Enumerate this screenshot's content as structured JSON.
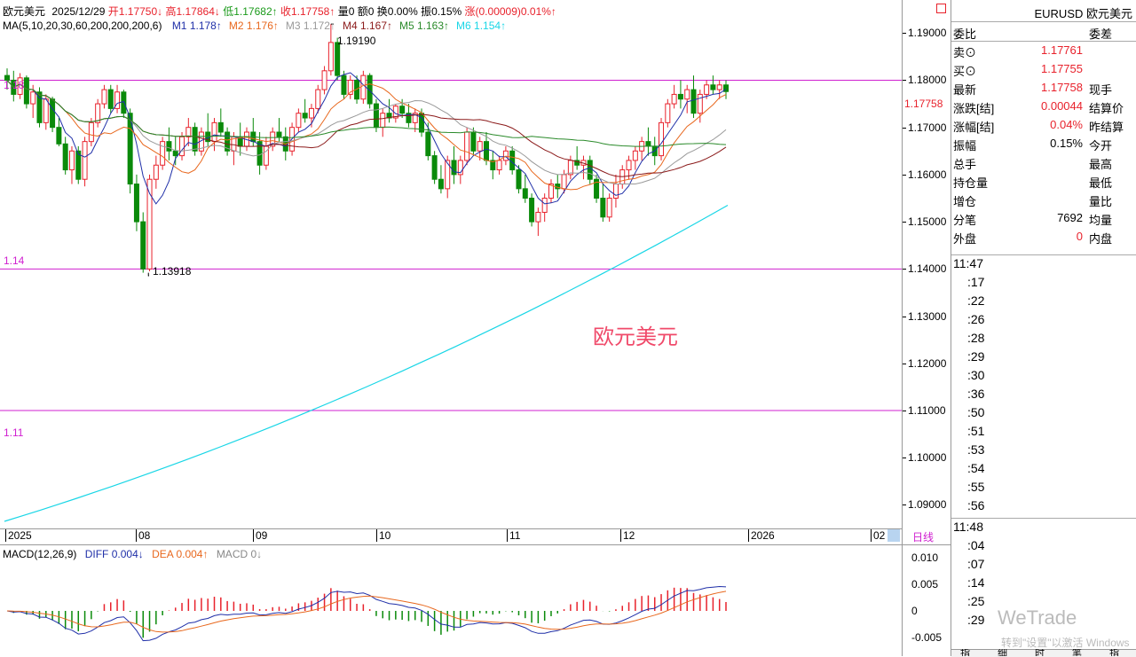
{
  "header": {
    "name": "欧元美元",
    "date": "2025/12/29",
    "open": "开1.17750↓",
    "high": "高1.17864↓",
    "low": "低1.17682↑",
    "close": "收1.17758↑",
    "vol": "量0",
    "amount": "额0",
    "turnover": "换0.00%",
    "amplitude": "振0.15%",
    "change": "涨(0.00009)0.01%↑"
  },
  "ma_legend": {
    "title": "MA(5,10,20,30,60,200,200,200,6)",
    "items": [
      {
        "label": "M1 ",
        "value": "1.178↑",
        "color": "#1f2fa8"
      },
      {
        "label": "M2 ",
        "value": "1.176↑",
        "color": "#e8681e"
      },
      {
        "label": "M3 ",
        "value": "1.172↑",
        "color": "#9a9a9a"
      },
      {
        "label": "M4 ",
        "value": "1.167↑",
        "color": "#8b1a1a"
      },
      {
        "label": "M5 ",
        "value": "1.163↑",
        "color": "#2a8a2a"
      },
      {
        "label": "M6 ",
        "value": "1.154↑",
        "color": "#19d6e6"
      }
    ]
  },
  "annotations": {
    "high_mark": "1.19190",
    "low_mark": "1.13918",
    "level_118": "1.18",
    "level_114": "1.14",
    "level_111": "1.11",
    "watermark": "欧元美元",
    "current_price": "1.17758"
  },
  "price_axis": [
    "1.19000",
    "1.18000",
    "1.17000",
    "1.16000",
    "1.15000",
    "1.14000",
    "1.13000",
    "1.12000",
    "1.11000",
    "1.10000",
    "1.09000"
  ],
  "macd_axis": [
    "0.010",
    "0.005",
    "0",
    "-0.005"
  ],
  "time_axis": [
    "2025",
    "08",
    "09",
    "10",
    "11",
    "12",
    "2026",
    "02"
  ],
  "period_button": "日线",
  "macd_legend": {
    "title": "MACD(12,26,9)",
    "diff": "DIFF 0.004↓",
    "dea": "DEA 0.004↑",
    "macd": "MACD 0↓"
  },
  "quote": {
    "symbol": "EURUSD 欧元美元",
    "ratio_label": "委比",
    "diff_label": "委差",
    "rows": [
      {
        "l": "卖⊙",
        "v": "1.17761",
        "vc": "red",
        "r": ""
      },
      {
        "l": "买⊙",
        "v": "1.17755",
        "vc": "red",
        "r": ""
      },
      {
        "l": "最新",
        "v": "1.17758",
        "vc": "red",
        "r": "现手"
      },
      {
        "l": "涨跌[结]",
        "v": "0.00044",
        "vc": "red",
        "r": "结算价"
      },
      {
        "l": "涨幅[结]",
        "v": "0.04%",
        "vc": "red",
        "r": "昨结算"
      },
      {
        "l": "振幅",
        "v": "0.15%",
        "vc": "",
        "r": "今开"
      },
      {
        "l": "总手",
        "v": "",
        "vc": "",
        "r": "最高"
      },
      {
        "l": "持仓量",
        "v": "",
        "vc": "",
        "r": "最低"
      },
      {
        "l": "增仓",
        "v": "",
        "vc": "",
        "r": "量比"
      },
      {
        "l": "分笔",
        "v": "7692",
        "vc": "",
        "r": "均量"
      },
      {
        "l": "外盘",
        "v": "0",
        "vc": "red",
        "r": "内盘"
      }
    ],
    "ticks_a": [
      "11:47",
      ":17",
      ":22",
      ":26",
      ":28",
      ":29",
      ":30",
      ":36",
      ":50",
      ":51",
      ":53",
      ":54",
      ":55",
      ":56"
    ],
    "ticks_b": [
      "11:48",
      ":04",
      ":07",
      ":14",
      ":25",
      ":29"
    ],
    "bottom_tabs": [
      "指",
      "细",
      "时",
      "笔",
      "指"
    ],
    "brand_watermark": "WeTrade",
    "activate_text": "转到\"设置\"以激活 Windows"
  },
  "chart_data": {
    "type": "candlestick",
    "title": "欧元美元",
    "y_range": [
      1.085,
      1.197
    ],
    "x_labels": [
      "2025",
      "08",
      "09",
      "10",
      "11",
      "12",
      "2026",
      "02"
    ],
    "reference_lines": [
      1.18,
      1.14,
      1.11
    ],
    "extremes": {
      "high": 1.1919,
      "low": 1.13918
    },
    "candles": [
      [
        1.181,
        1.1825,
        1.178,
        1.18
      ],
      [
        1.18,
        1.182,
        1.1755,
        1.177
      ],
      [
        1.177,
        1.1815,
        1.176,
        1.1805
      ],
      [
        1.1805,
        1.181,
        1.174,
        1.175
      ],
      [
        1.175,
        1.179,
        1.172,
        1.1775
      ],
      [
        1.1775,
        1.1785,
        1.17,
        1.171
      ],
      [
        1.171,
        1.177,
        1.1695,
        1.176
      ],
      [
        1.176,
        1.1765,
        1.169,
        1.17
      ],
      [
        1.17,
        1.172,
        1.166,
        1.1665
      ],
      [
        1.1665,
        1.168,
        1.16,
        1.161
      ],
      [
        1.161,
        1.166,
        1.158,
        1.165
      ],
      [
        1.165,
        1.166,
        1.158,
        1.159
      ],
      [
        1.159,
        1.168,
        1.1575,
        1.167
      ],
      [
        1.167,
        1.172,
        1.166,
        1.171
      ],
      [
        1.171,
        1.176,
        1.17,
        1.175
      ],
      [
        1.175,
        1.179,
        1.174,
        1.178
      ],
      [
        1.178,
        1.179,
        1.173,
        1.174
      ],
      [
        1.174,
        1.179,
        1.173,
        1.1775
      ],
      [
        1.1775,
        1.178,
        1.172,
        1.173
      ],
      [
        1.173,
        1.174,
        1.156,
        1.158
      ],
      [
        1.158,
        1.16,
        1.148,
        1.15
      ],
      [
        1.15,
        1.152,
        1.1392,
        1.14
      ],
      [
        1.14,
        1.16,
        1.1395,
        1.159
      ],
      [
        1.159,
        1.164,
        1.157,
        1.162
      ],
      [
        1.162,
        1.168,
        1.161,
        1.167
      ],
      [
        1.167,
        1.17,
        1.163,
        1.165
      ],
      [
        1.165,
        1.168,
        1.162,
        1.164
      ],
      [
        1.164,
        1.169,
        1.163,
        1.168
      ],
      [
        1.168,
        1.172,
        1.166,
        1.17
      ],
      [
        1.17,
        1.171,
        1.164,
        1.165
      ],
      [
        1.165,
        1.17,
        1.164,
        1.169
      ],
      [
        1.169,
        1.173,
        1.166,
        1.167
      ],
      [
        1.167,
        1.172,
        1.165,
        1.171
      ],
      [
        1.171,
        1.174,
        1.168,
        1.169
      ],
      [
        1.169,
        1.17,
        1.164,
        1.165
      ],
      [
        1.165,
        1.169,
        1.162,
        1.168
      ],
      [
        1.168,
        1.171,
        1.164,
        1.166
      ],
      [
        1.166,
        1.17,
        1.165,
        1.169
      ],
      [
        1.169,
        1.172,
        1.166,
        1.167
      ],
      [
        1.167,
        1.169,
        1.16,
        1.162
      ],
      [
        1.162,
        1.168,
        1.161,
        1.166
      ],
      [
        1.166,
        1.17,
        1.165,
        1.169
      ],
      [
        1.169,
        1.172,
        1.167,
        1.168
      ],
      [
        1.168,
        1.17,
        1.163,
        1.165
      ],
      [
        1.165,
        1.171,
        1.164,
        1.17
      ],
      [
        1.17,
        1.174,
        1.169,
        1.173
      ],
      [
        1.173,
        1.176,
        1.171,
        1.172
      ],
      [
        1.172,
        1.175,
        1.17,
        1.174
      ],
      [
        1.174,
        1.179,
        1.173,
        1.178
      ],
      [
        1.178,
        1.183,
        1.177,
        1.182
      ],
      [
        1.182,
        1.1919,
        1.181,
        1.188
      ],
      [
        1.188,
        1.189,
        1.18,
        1.181
      ],
      [
        1.181,
        1.182,
        1.176,
        1.177
      ],
      [
        1.177,
        1.181,
        1.176,
        1.18
      ],
      [
        1.18,
        1.181,
        1.175,
        1.176
      ],
      [
        1.176,
        1.182,
        1.175,
        1.181
      ],
      [
        1.181,
        1.1815,
        1.174,
        1.175
      ],
      [
        1.175,
        1.176,
        1.169,
        1.17
      ],
      [
        1.17,
        1.174,
        1.168,
        1.173
      ],
      [
        1.173,
        1.176,
        1.171,
        1.172
      ],
      [
        1.172,
        1.175,
        1.171,
        1.1745
      ],
      [
        1.1745,
        1.176,
        1.172,
        1.173
      ],
      [
        1.173,
        1.175,
        1.17,
        1.171
      ],
      [
        1.171,
        1.174,
        1.169,
        1.173
      ],
      [
        1.173,
        1.174,
        1.168,
        1.169
      ],
      [
        1.169,
        1.171,
        1.163,
        1.164
      ],
      [
        1.164,
        1.165,
        1.158,
        1.159
      ],
      [
        1.159,
        1.162,
        1.156,
        1.157
      ],
      [
        1.157,
        1.164,
        1.155,
        1.163
      ],
      [
        1.163,
        1.166,
        1.158,
        1.16
      ],
      [
        1.16,
        1.164,
        1.158,
        1.163
      ],
      [
        1.163,
        1.17,
        1.162,
        1.169
      ],
      [
        1.169,
        1.17,
        1.164,
        1.165
      ],
      [
        1.165,
        1.168,
        1.163,
        1.167
      ],
      [
        1.167,
        1.169,
        1.162,
        1.163
      ],
      [
        1.163,
        1.165,
        1.159,
        1.161
      ],
      [
        1.161,
        1.164,
        1.16,
        1.163
      ],
      [
        1.163,
        1.166,
        1.162,
        1.165
      ],
      [
        1.165,
        1.166,
        1.16,
        1.161
      ],
      [
        1.161,
        1.162,
        1.156,
        1.157
      ],
      [
        1.157,
        1.16,
        1.154,
        1.155
      ],
      [
        1.155,
        1.156,
        1.149,
        1.15
      ],
      [
        1.15,
        1.153,
        1.147,
        1.152
      ],
      [
        1.152,
        1.156,
        1.15,
        1.155
      ],
      [
        1.155,
        1.159,
        1.154,
        1.158
      ],
      [
        1.158,
        1.16,
        1.155,
        1.157
      ],
      [
        1.157,
        1.161,
        1.156,
        1.16
      ],
      [
        1.16,
        1.164,
        1.159,
        1.163
      ],
      [
        1.163,
        1.166,
        1.161,
        1.162
      ],
      [
        1.162,
        1.164,
        1.159,
        1.163
      ],
      [
        1.163,
        1.164,
        1.158,
        1.159
      ],
      [
        1.159,
        1.16,
        1.154,
        1.155
      ],
      [
        1.155,
        1.158,
        1.15,
        1.151
      ],
      [
        1.151,
        1.156,
        1.15,
        1.155
      ],
      [
        1.155,
        1.16,
        1.153,
        1.158
      ],
      [
        1.158,
        1.162,
        1.157,
        1.161
      ],
      [
        1.161,
        1.164,
        1.159,
        1.163
      ],
      [
        1.163,
        1.166,
        1.161,
        1.165
      ],
      [
        1.165,
        1.168,
        1.163,
        1.167
      ],
      [
        1.167,
        1.17,
        1.164,
        1.166
      ],
      [
        1.166,
        1.168,
        1.162,
        1.164
      ],
      [
        1.164,
        1.172,
        1.163,
        1.171
      ],
      [
        1.171,
        1.176,
        1.17,
        1.175
      ],
      [
        1.175,
        1.179,
        1.174,
        1.177
      ],
      [
        1.177,
        1.18,
        1.174,
        1.176
      ],
      [
        1.176,
        1.179,
        1.173,
        1.178
      ],
      [
        1.178,
        1.181,
        1.172,
        1.173
      ],
      [
        1.173,
        1.178,
        1.171,
        1.177
      ],
      [
        1.177,
        1.18,
        1.176,
        1.179
      ],
      [
        1.179,
        1.181,
        1.177,
        1.178
      ],
      [
        1.178,
        1.18,
        1.176,
        1.179
      ],
      [
        1.179,
        1.18,
        1.176,
        1.1776
      ]
    ],
    "macd_range": [
      -0.0085,
      0.0125
    ]
  }
}
